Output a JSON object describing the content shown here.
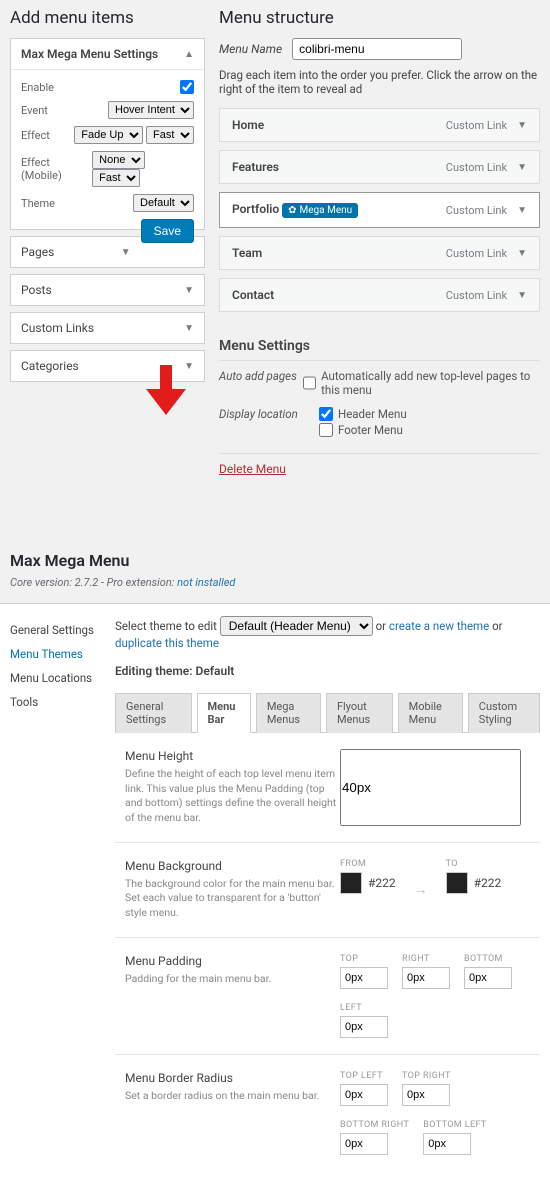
{
  "left": {
    "heading": "Add menu items",
    "settings_panel": "Max Mega Menu Settings",
    "rows": {
      "enable": "Enable",
      "event": "Event",
      "event_val": "Hover Intent",
      "effect": "Effect",
      "effect_val": "Fade Up",
      "effect_speed": "Fast",
      "effect_mobile": "Effect (Mobile)",
      "effect_mobile_val": "None",
      "effect_mobile_speed": "Fast",
      "theme": "Theme",
      "theme_val": "Default"
    },
    "save": "Save",
    "panels": [
      "Pages",
      "Posts",
      "Custom Links",
      "Categories"
    ]
  },
  "right": {
    "heading": "Menu structure",
    "menu_name_label": "Menu Name",
    "menu_name_value": "colibri-menu",
    "instructions": "Drag each item into the order you prefer. Click the arrow on the right of the item to reveal ad",
    "items": [
      {
        "label": "Home",
        "type": "Custom Link",
        "mega": false
      },
      {
        "label": "Features",
        "type": "Custom Link",
        "mega": false
      },
      {
        "label": "Portfolio",
        "type": "Custom Link",
        "mega": true,
        "mega_label": "Mega Menu"
      },
      {
        "label": "Team",
        "type": "Custom Link",
        "mega": false
      },
      {
        "label": "Contact",
        "type": "Custom Link",
        "mega": false
      }
    ],
    "settings": {
      "heading": "Menu Settings",
      "auto_add": "Auto add pages",
      "auto_add_label": "Automatically add new top-level pages to this menu",
      "display": "Display location",
      "header": "Header Menu",
      "footer": "Footer Menu"
    },
    "delete": "Delete Menu"
  },
  "mmm": {
    "title": "Max Mega Menu",
    "version_pre": "Core version: 2.7.2 - Pro extension: ",
    "version_link": "not installed",
    "side": [
      "General Settings",
      "Menu Themes",
      "Menu Locations",
      "Tools"
    ],
    "select_pre": "Select theme to edit",
    "select_val": "Default (Header Menu)",
    "or": " or ",
    "create": "create a new theme",
    "duplicate": "duplicate this theme",
    "editing": "Editing theme: Default",
    "tabs": [
      "General Settings",
      "Menu Bar",
      "Mega Menus",
      "Flyout Menus",
      "Mobile Menu",
      "Custom Styling"
    ],
    "rows": {
      "height": {
        "title": "Menu Height",
        "desc": "Define the height of each top level menu item link. This value plus the Menu Padding (top and bottom) settings define the overall height of the menu bar.",
        "val": "40px"
      },
      "bg": {
        "title": "Menu Background",
        "desc": "The background color for the main menu bar. Set each value to transparent for a 'button' style menu.",
        "from_label": "FROM",
        "from": "#222",
        "to_label": "TO",
        "to": "#222"
      },
      "padding": {
        "title": "Menu Padding",
        "desc": "Padding for the main menu bar.",
        "labels": [
          "TOP",
          "RIGHT",
          "BOTTOM",
          "LEFT"
        ],
        "val": "0px"
      },
      "radius": {
        "title": "Menu Border Radius",
        "desc": "Set a border radius on the main menu bar.",
        "labels": [
          "TOP LEFT",
          "TOP RIGHT",
          "BOTTOM RIGHT",
          "BOTTOM LEFT"
        ],
        "val": "0px"
      }
    }
  }
}
